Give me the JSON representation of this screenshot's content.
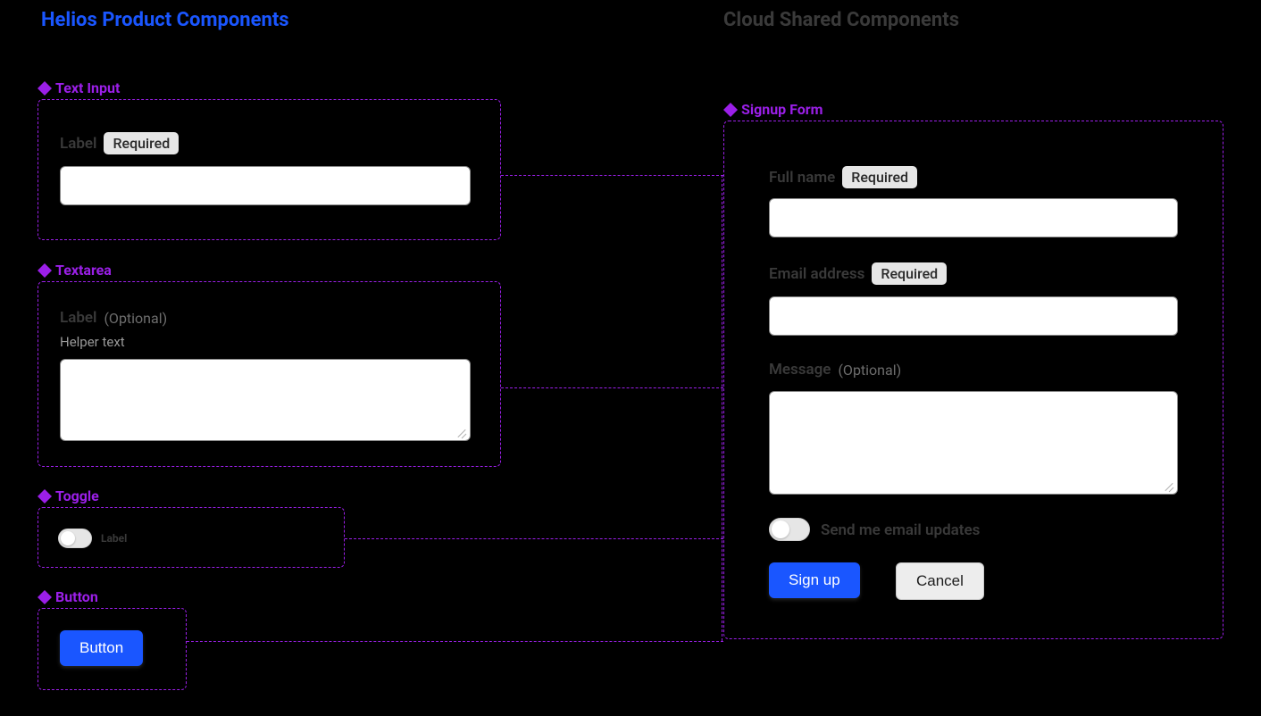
{
  "titles": {
    "left": "Helios Product Components",
    "right": "Cloud Shared Components"
  },
  "components": {
    "text_input": {
      "name": "Text Input",
      "label": "Label",
      "badge": "Required"
    },
    "textarea": {
      "name": "Textarea",
      "label": "Label",
      "optional": "(Optional)",
      "helper": "Helper text"
    },
    "toggle": {
      "name": "Toggle",
      "label": "Label"
    },
    "button": {
      "name": "Button",
      "label": "Button"
    }
  },
  "signup": {
    "name": "Signup Form",
    "full_name": {
      "label": "Full name",
      "badge": "Required"
    },
    "email": {
      "label": "Email address",
      "badge": "Required"
    },
    "message": {
      "label": "Message",
      "optional": "(Optional)"
    },
    "toggle_label": "Send me email updates",
    "primary_btn": "Sign up",
    "secondary_btn": "Cancel"
  }
}
